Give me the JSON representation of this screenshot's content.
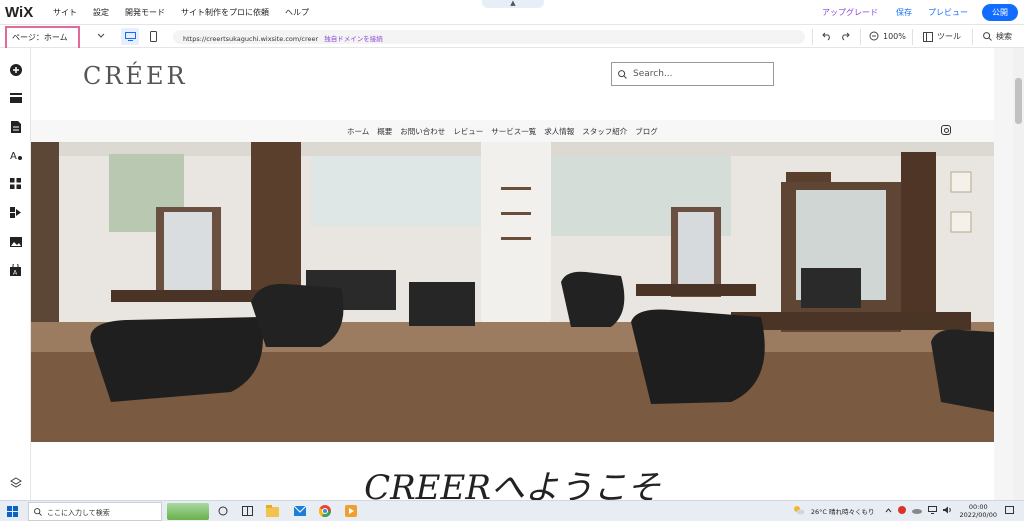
{
  "editor": {
    "logo": "WiX",
    "menu": [
      "サイト",
      "設定",
      "開発モード",
      "サイト制作をプロに依頼",
      "ヘルプ"
    ],
    "collapse_glyph": "▲",
    "upgrade": "アップグレード",
    "save": "保存",
    "preview": "プレビュー",
    "publish": "公開"
  },
  "toolbar": {
    "page_select": "ページ：ホーム",
    "url": "https://creertsukaguchi.wixsite.com/creer",
    "url_link": "独自ドメインを接続",
    "zoom": "100%",
    "tools": "ツール",
    "search": "検索"
  },
  "site": {
    "logo": "CRÉER",
    "search_placeholder": "Search...",
    "nav": [
      "ホーム",
      "概要",
      "お問い合わせ",
      "レビュー",
      "サービス一覧",
      "求人情報",
      "スタッフ紹介",
      "ブログ"
    ],
    "welcome": "CREERへようこそ"
  },
  "taskbar": {
    "search": "ここに入力して検索",
    "weather": "26°C  晴れ時々くもり",
    "time": "00:00",
    "date": "2022/00/00"
  },
  "colors": {
    "wix_blue": "#116dff",
    "upgrade_purple": "#8a44d6",
    "highlight_pink": "#e06b9b"
  }
}
